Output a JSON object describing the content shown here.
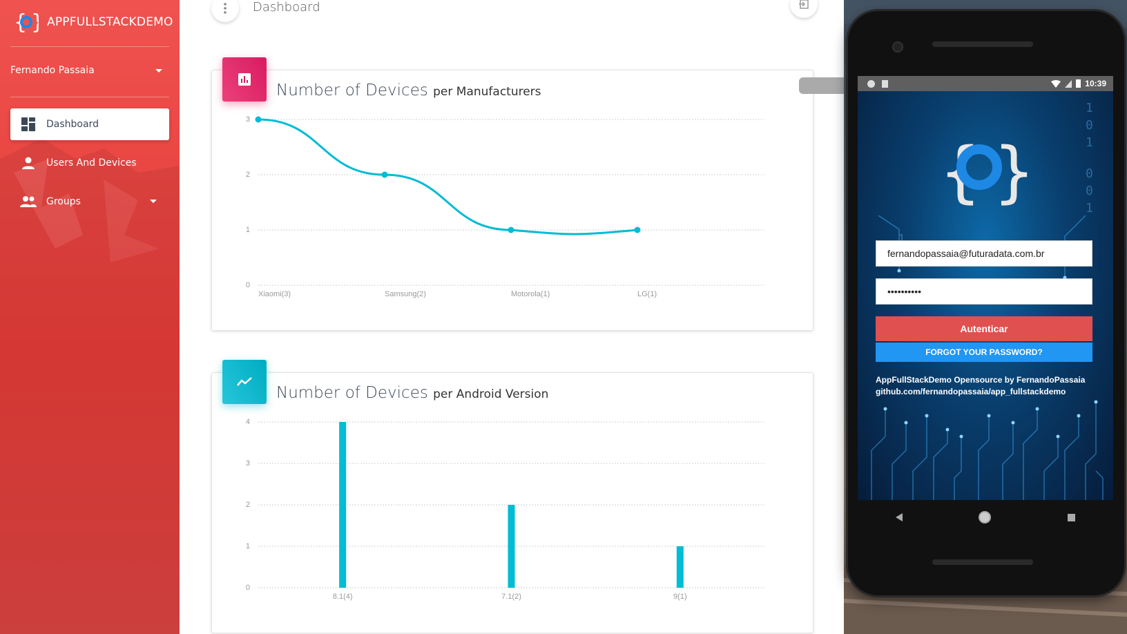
{
  "sidebar": {
    "brand": "APPFULLSTACKDEMO",
    "user": "Fernando Passaia",
    "items": [
      {
        "label": "Dashboard",
        "icon": "dashboard-icon",
        "active": true
      },
      {
        "label": "Users And Devices",
        "icon": "person-icon",
        "active": false
      },
      {
        "label": "Groups",
        "icon": "group-icon",
        "active": false
      }
    ],
    "accent": "#e53935"
  },
  "header": {
    "title": "Dashboard"
  },
  "cards": [
    {
      "title": "Number of Devices",
      "subtitle": "per Manufacturers",
      "icon": "bar-chart-icon",
      "icon_color": "#e91e63"
    },
    {
      "title": "Number of Devices",
      "subtitle": "per Android Version",
      "icon": "trending-icon",
      "icon_color": "#26c6da"
    }
  ],
  "chart_data": [
    {
      "type": "line",
      "categories": [
        "Xiaomi(3)",
        "Samsung(2)",
        "Motorola(1)",
        "LG(1)"
      ],
      "values": [
        3,
        2,
        1,
        1
      ],
      "ylim": [
        0,
        3
      ],
      "yticks": [
        0,
        1,
        2,
        3
      ],
      "grid": true,
      "color": "#00bcd4"
    },
    {
      "type": "bar",
      "categories": [
        "8.1(4)",
        "7.1(2)",
        "9(1)"
      ],
      "values": [
        4,
        2,
        1
      ],
      "ylim": [
        0,
        4
      ],
      "yticks": [
        0,
        1,
        2,
        3,
        4
      ],
      "grid": true,
      "color": "#00bcd4"
    }
  ],
  "phone": {
    "time": "10:39",
    "email": "fernandopassaia@futuradata.com.br",
    "password_mask": "••••••••••",
    "login_button": "Autenticar",
    "forgot_button": "FORGOT YOUR PASSWORD?",
    "footer_line1": "AppFullStackDemo Opensource by FernandoPassaia",
    "footer_line2": "github.com/fernandopassaia/app_fullstackdemo",
    "login_color": "#e05050",
    "forgot_color": "#2196f3"
  }
}
